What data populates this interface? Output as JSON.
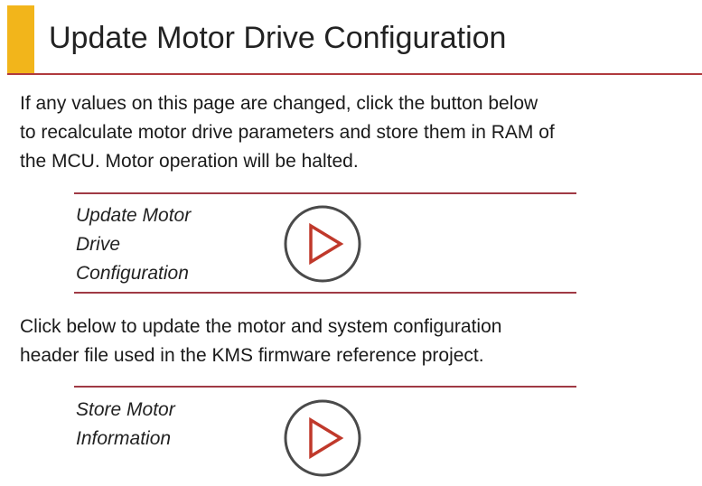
{
  "header": {
    "title": "Update Motor Drive Configuration"
  },
  "section_update": {
    "description_lines": [
      "If any values on this page are changed, click the button below",
      "to recalculate motor drive parameters and store them in RAM of",
      "the MCU.  Motor operation will be halted."
    ],
    "action_label_lines": [
      "Update Motor",
      "Drive",
      "Configuration"
    ],
    "button_icon": "play-icon"
  },
  "section_store": {
    "description_lines": [
      "Click below to update the motor and system configuration",
      "header file used in the KMS firmware reference project."
    ],
    "action_label_lines": [
      "Store Motor",
      "Information"
    ],
    "button_icon": "play-icon"
  },
  "colors": {
    "accent": "#f2b51b",
    "rule": "#b03a3e",
    "icon_circle": "#4a4a4a",
    "icon_triangle": "#c0392b"
  }
}
